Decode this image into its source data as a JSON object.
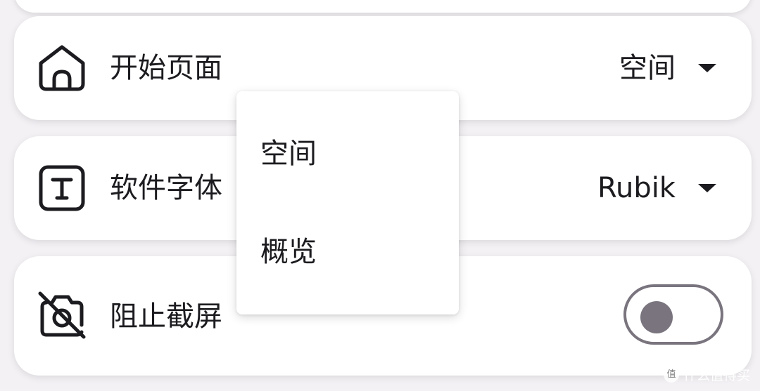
{
  "settings": {
    "start_page": {
      "icon": "home-icon",
      "label": "开始页面",
      "value": "空间"
    },
    "app_font": {
      "icon": "text-font-icon",
      "label": "软件字体",
      "value": "Rubik"
    },
    "block_screenshot": {
      "icon": "screenshot-blocked-icon",
      "label": "阻止截屏",
      "toggle_on": false
    }
  },
  "dropdown": {
    "options": [
      "空间",
      "概览"
    ]
  },
  "watermark": {
    "logo_text": "值",
    "text": "什么值得买"
  },
  "colors": {
    "background": "#f3f1f4",
    "card": "#ffffff",
    "text": "#1c1b1f",
    "toggle_outline": "#79747e"
  }
}
